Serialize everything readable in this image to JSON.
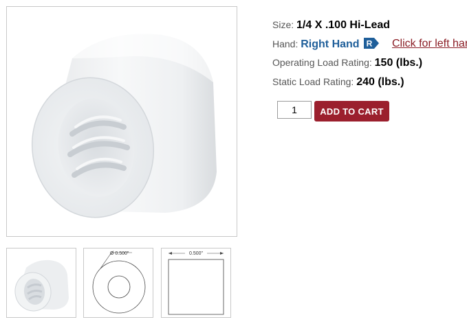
{
  "product": {
    "size_label": "Size:",
    "size_value": "1/4 X .100 Hi-Lead",
    "hand_label": "Hand:",
    "hand_value": "Right Hand",
    "hand_badge": "R",
    "left_hand_link": "Click for left hand",
    "operating_label": "Operating Load Rating:",
    "operating_value": "150 (lbs.)",
    "static_label": "Static Load Rating:",
    "static_value": "240 (lbs.)"
  },
  "cart": {
    "quantity": "1",
    "add_label": "ADD TO CART"
  },
  "drawings": {
    "diameter_label": "Ø 0.500\"",
    "length_label": "0.500\""
  },
  "colors": {
    "accent": "#9b1f2d",
    "hand_blue": "#1f5f9a",
    "link_red": "#8a1c24"
  },
  "icons": {
    "hand_badge": "right-hand-badge-icon"
  }
}
